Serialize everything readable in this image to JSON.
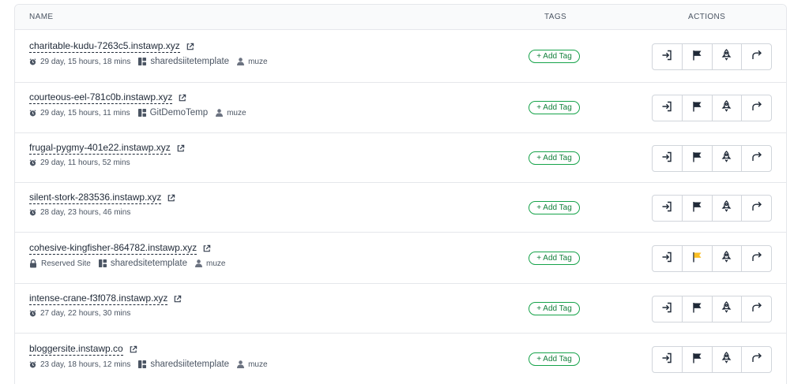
{
  "table": {
    "headers": {
      "name": "NAME",
      "tags": "TAGS",
      "actions": "ACTIONS"
    }
  },
  "colors": {
    "flag_default": "#1f2937",
    "flag_reserved": "#fbbf24",
    "tag_accent": "#16a34a"
  },
  "add_tag_label": "+ Add Tag",
  "rows": [
    {
      "site": "charitable-kudu-7263c5.instawp.xyz",
      "time": "29 day, 15 hours, 18 mins",
      "template": "sharedsiitetemplate",
      "user": "muze",
      "reserved": "",
      "flag": "default"
    },
    {
      "site": "courteous-eel-781c0b.instawp.xyz",
      "time": "29 day, 15 hours, 11 mins",
      "template": "GitDemoTemp",
      "user": "muze",
      "reserved": "",
      "flag": "default"
    },
    {
      "site": "frugal-pygmy-401e22.instawp.xyz",
      "time": "29 day, 11 hours, 52 mins",
      "template": "",
      "user": "",
      "reserved": "",
      "flag": "default"
    },
    {
      "site": "silent-stork-283536.instawp.xyz",
      "time": "28 day, 23 hours, 46 mins",
      "template": "",
      "user": "",
      "reserved": "",
      "flag": "default"
    },
    {
      "site": "cohesive-kingfisher-864782.instawp.xyz",
      "time": "",
      "template": "sharedsitetemplate",
      "user": "muze",
      "reserved": "Reserved Site",
      "flag": "reserved"
    },
    {
      "site": "intense-crane-f3f078.instawp.xyz",
      "time": "27 day, 22 hours, 30 mins",
      "template": "",
      "user": "",
      "reserved": "",
      "flag": "default"
    },
    {
      "site": "bloggersite.instawp.co",
      "time": "23 day, 18 hours, 12 mins",
      "template": "sharedsiitetemplate",
      "user": "muze",
      "reserved": "",
      "flag": "default"
    }
  ]
}
